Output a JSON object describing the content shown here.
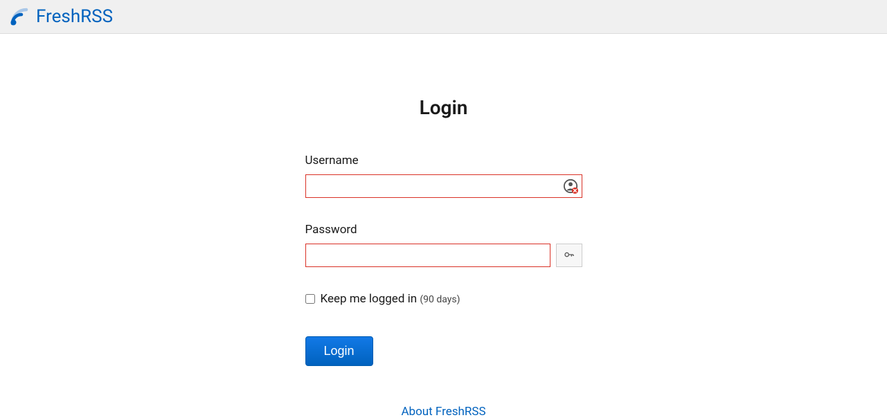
{
  "header": {
    "brand": "FreshRSS"
  },
  "login": {
    "title": "Login",
    "username_label": "Username",
    "username_value": "",
    "password_label": "Password",
    "password_value": "",
    "keep_logged_label": "Keep me logged in ",
    "keep_logged_note": "(90 days)",
    "submit_label": "Login"
  },
  "footer": {
    "about_label": "About FreshRSS"
  }
}
